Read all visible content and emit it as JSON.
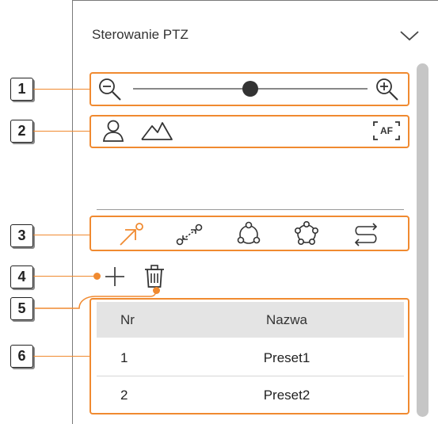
{
  "panel": {
    "title": "Sterowanie PTZ",
    "collapse_icon": "chevron-down-icon"
  },
  "callouts": [
    "1",
    "2",
    "3",
    "4",
    "5",
    "6"
  ],
  "zoom": {
    "zoom_out_icon": "zoom-out-icon",
    "zoom_in_icon": "zoom-in-icon",
    "slider_level": 0.5
  },
  "focus": {
    "icons": [
      "person-icon",
      "mountain-icon"
    ],
    "af_label": "AF"
  },
  "modes": {
    "icons": [
      "preset-icon",
      "swing-icon",
      "group-icon",
      "tour-icon",
      "trace-icon"
    ],
    "active_index": 0
  },
  "actions": {
    "add_icon": "plus-icon",
    "delete_icon": "trash-icon"
  },
  "table": {
    "headers": {
      "nr": "Nr",
      "name": "Nazwa"
    },
    "rows": [
      {
        "nr": "1",
        "name": "Preset1"
      },
      {
        "nr": "2",
        "name": "Preset2"
      }
    ]
  },
  "colors": {
    "accent": "#f08a30",
    "icon": "#333333",
    "header_bg": "#e4e4e4"
  }
}
